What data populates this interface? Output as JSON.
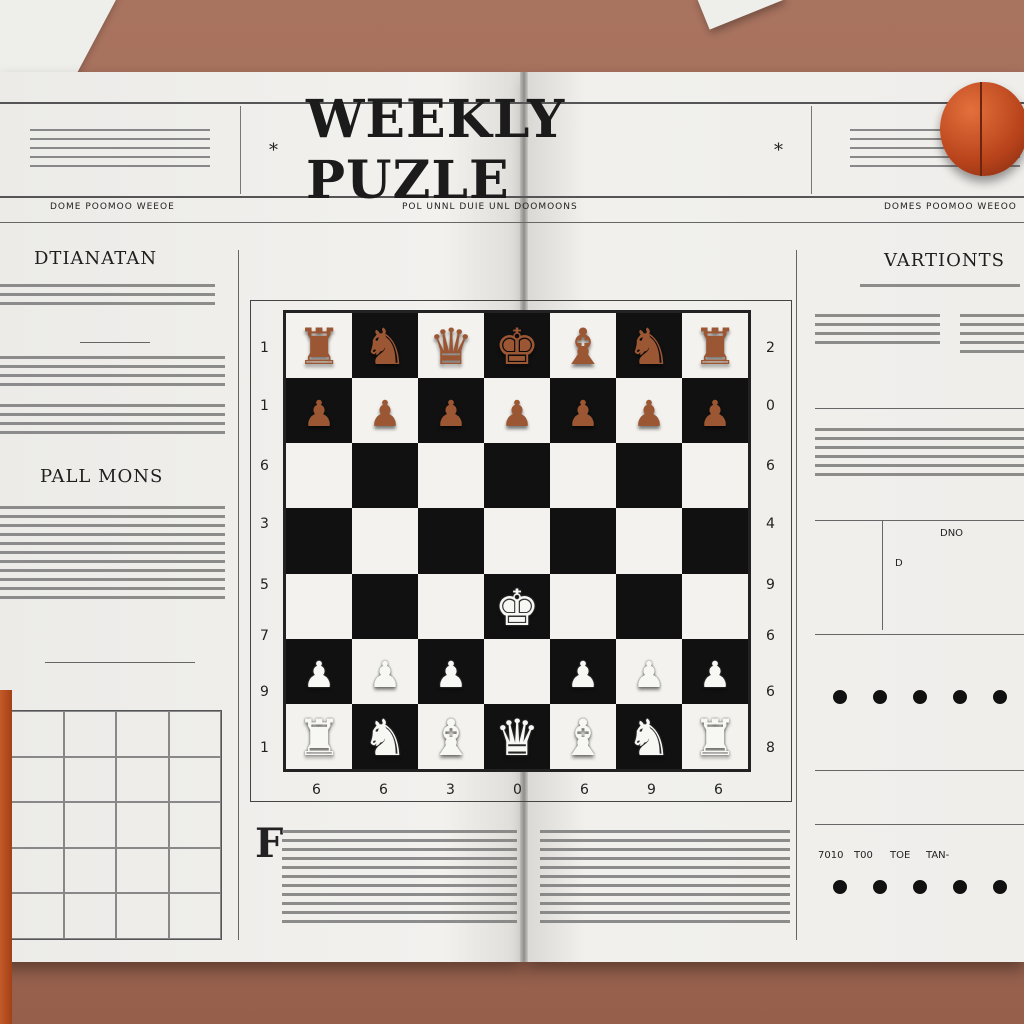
{
  "header": {
    "title": "WEEKLY PUZLE",
    "star_left": "*",
    "star_right": "*"
  },
  "subheads": {
    "left": "DOME POOMOO WEEOE",
    "center": "POL  UNNL  DUIE  UNL  DOOMOONS",
    "right": "DOMES POOMOO WEEOO"
  },
  "left_column": {
    "heading_1": "DTIANATAN",
    "heading_2": "PALL MONS"
  },
  "right_column": {
    "heading": "VARTIONTS",
    "table_label_1": "DNO",
    "table_label_2": "D"
  },
  "footer_labels": [
    "7010",
    "T00",
    "TOE",
    "TAN-"
  ],
  "rank_labels_left": [
    "1",
    "1",
    "6",
    "3",
    "5",
    "7",
    "9",
    "1"
  ],
  "rank_labels_right": [
    "2",
    "0",
    "6",
    "4",
    "9",
    "6",
    "6",
    "8"
  ],
  "file_labels": [
    "6",
    "6",
    "3",
    "0",
    "6",
    "9",
    "6"
  ],
  "board": {
    "rows": [
      [
        "black-rook",
        "black-knight",
        "black-queen",
        "black-king",
        "black-bishop",
        "black-knight",
        "black-rook"
      ],
      [
        "black-pawn",
        "black-pawn",
        "black-pawn",
        "black-pawn",
        "black-pawn",
        "black-pawn",
        "black-pawn"
      ],
      [
        "",
        "",
        "",
        "",
        "",
        "",
        ""
      ],
      [
        "",
        "",
        "",
        "",
        "",
        "",
        ""
      ],
      [
        "",
        "",
        "",
        "white-king",
        "",
        "",
        ""
      ],
      [
        "white-pawn",
        "white-pawn",
        "white-pawn",
        "",
        "white-pawn",
        "white-pawn",
        "white-pawn"
      ],
      [
        "white-rook",
        "white-knight",
        "white-bishop",
        "white-queen",
        "white-bishop",
        "white-knight",
        "white-rook"
      ]
    ]
  },
  "colors": {
    "dark_square": "#111111",
    "light_square": "#f3f2ee",
    "black_piece": "#9b5633",
    "white_piece": "#f7f7f4"
  },
  "glyphs": {
    "black-rook": "♜",
    "black-knight": "♞",
    "black-bishop": "♝",
    "black-queen": "♛",
    "black-king": "♚",
    "black-pawn": "♟",
    "white-rook": "♜",
    "white-knight": "♞",
    "white-bishop": "♝",
    "white-queen": "♛",
    "white-king": "♚",
    "white-pawn": "♟"
  }
}
